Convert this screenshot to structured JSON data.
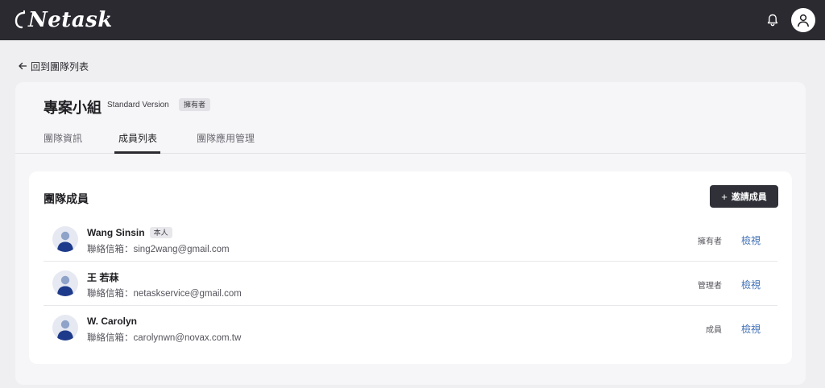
{
  "app": {
    "logo_text": "Netask",
    "logo_icon": "netask-logo-icon"
  },
  "header": {
    "notification_icon": "bell-icon",
    "avatar_icon": "user-avatar-icon"
  },
  "back_link": {
    "icon": "arrow-left-icon",
    "label": "回到團隊列表"
  },
  "team": {
    "name": "專案小組",
    "version": "Standard Version",
    "role_badge": "擁有者"
  },
  "tabs": [
    {
      "label": "團隊資訊",
      "active": false
    },
    {
      "label": "成員列表",
      "active": true
    },
    {
      "label": "團隊應用管理",
      "active": false
    }
  ],
  "members_card": {
    "title": "團隊成員",
    "invite_button": {
      "icon": "+",
      "label": "邀請成員"
    },
    "email_label": "聯絡信箱：",
    "view_label": "檢視",
    "members": [
      {
        "name": "Wang Sinsin",
        "self_badge": "本人",
        "email": "sing2wang@gmail.com",
        "role": "擁有者"
      },
      {
        "name": "王 若菻",
        "self_badge": "",
        "email": "netaskservice@gmail.com",
        "role": "管理者"
      },
      {
        "name": "W. Carolyn",
        "self_badge": "",
        "email": "carolynwn@novax.com.tw",
        "role": "成員"
      }
    ]
  },
  "colors": {
    "topbar": "#2a2a30",
    "link": "#3f6fb4",
    "avatar_body": "#1e3a8a",
    "avatar_head": "#8fa3c9"
  }
}
